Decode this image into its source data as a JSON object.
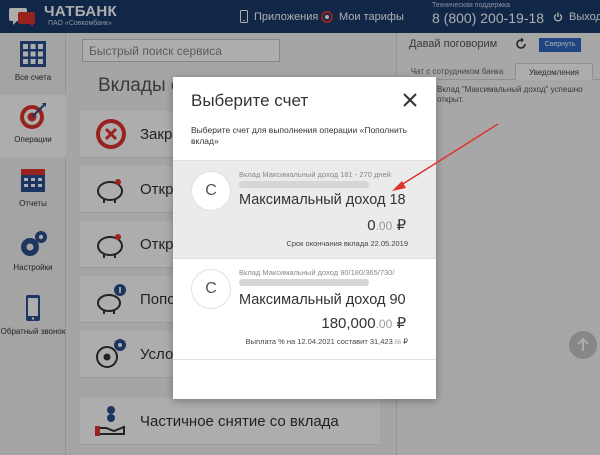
{
  "header": {
    "brand": "ЧАТБАНК",
    "brand_sub": "ПАО «Совкомбанк»",
    "apps_label": "Приложения",
    "tariffs_label": "Мои тарифы",
    "support_label": "Техническая поддержка",
    "support_phone": "8 (800) 200-19-18",
    "logout_label": "Выход"
  },
  "sidebar": {
    "items": [
      {
        "label": "Все счета",
        "icon": "grid-icon"
      },
      {
        "label": "Операции",
        "icon": "target-icon"
      },
      {
        "label": "Отчеты",
        "icon": "calendar-icon"
      },
      {
        "label": "Настройки",
        "icon": "gears-icon"
      },
      {
        "label": "Обратный звонок",
        "icon": "phone-icon"
      }
    ]
  },
  "main": {
    "search_placeholder": "Быстрый поиск сервиса",
    "section_title": "Вклады с",
    "operations": [
      {
        "label": "Закры"
      },
      {
        "label": "Откры"
      },
      {
        "label": "Откры"
      },
      {
        "label": "Попол"
      },
      {
        "label": "Услов"
      },
      {
        "label": "Частичное снятие со вклада"
      }
    ]
  },
  "chat": {
    "title": "Давай поговорим",
    "collapse_label": "Свернуть",
    "tabs": [
      "Чат с сотрудником банка",
      "Уведомления"
    ],
    "message": "Вклад \"Максимальный доход\" успешно открыт."
  },
  "modal": {
    "title": "Выберите счет",
    "description": "Выберите счет для выполнения операции «Пополнить вклад»",
    "accounts": [
      {
        "avatar": "С",
        "type": "Вклад Максимальный доход 181 - 270 дней",
        "name": "Максимальный доход 18",
        "amount_main": "0",
        "amount_cents": ".00",
        "currency": "₽",
        "footer": "Срок окончания вклада 22.05.2019",
        "footer_cents": ""
      },
      {
        "avatar": "С",
        "type": "Вклад Максимальный доход 90/180/365/730/",
        "name": "Максимальный доход 90",
        "amount_main": "180,000",
        "amount_cents": ".00",
        "currency": "₽",
        "footer": "Выплата % на 12.04.2021 составит 31,423",
        "footer_cents": ".56",
        "footer_currency": "₽"
      }
    ]
  },
  "colors": {
    "header_bg": "#1a3a6b",
    "accent": "#2f68c2",
    "annotation_arrow": "#e0332d"
  }
}
